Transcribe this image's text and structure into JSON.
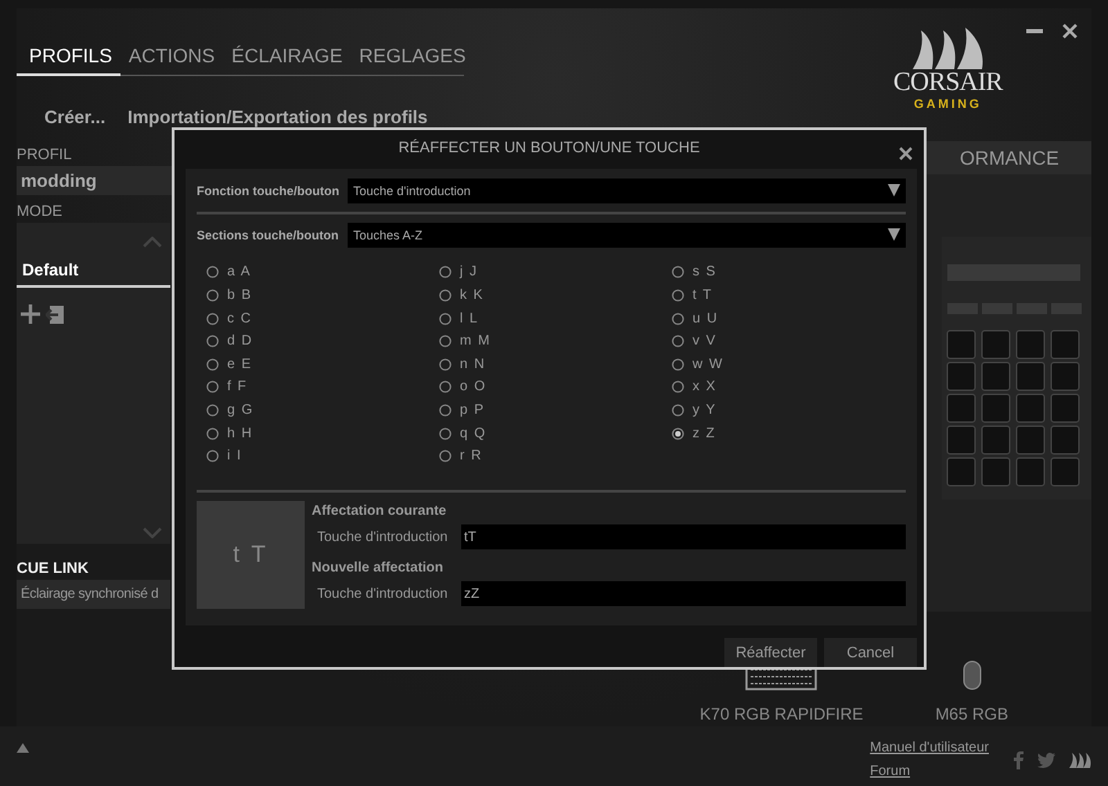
{
  "tabs": [
    {
      "label": "PROFILS",
      "selected": true
    },
    {
      "label": "ACTIONS",
      "selected": false
    },
    {
      "label": "ÉCLAIRAGE",
      "selected": false
    },
    {
      "label": "REGLAGES",
      "selected": false
    }
  ],
  "logo": {
    "name": "CORSAIR",
    "sub": "GAMING"
  },
  "subnav": [
    "Créer...",
    "Importation/Exportation des profils"
  ],
  "profile": {
    "label": "PROFIL",
    "value": "modding"
  },
  "mode": {
    "label": "MODE",
    "items": [
      {
        "label": "Default",
        "selected": true
      }
    ]
  },
  "cue_link": {
    "label": "CUE LINK",
    "value": "Éclairage synchronisé d"
  },
  "right_panel": {
    "tab": "ORMANCE"
  },
  "devices": [
    {
      "name": "K70 RGB RAPIDFIRE",
      "kind": "keyboard"
    },
    {
      "name": "M65 RGB",
      "kind": "mouse"
    }
  ],
  "footer": {
    "links": [
      "Manuel d'utilisateur",
      "Forum"
    ]
  },
  "dialog": {
    "title": "RÉAFFECTER UN BOUTON/UNE TOUCHE",
    "fields": [
      {
        "label": "Fonction touche/bouton",
        "value": "Touche d'introduction"
      },
      {
        "label": "Sections touche/bouton",
        "value": "Touches A-Z"
      }
    ],
    "key_columns": [
      [
        {
          "label": "a A",
          "selected": false
        },
        {
          "label": "b B",
          "selected": false
        },
        {
          "label": "c C",
          "selected": false
        },
        {
          "label": "d D",
          "selected": false
        },
        {
          "label": "e E",
          "selected": false
        },
        {
          "label": "f F",
          "selected": false
        },
        {
          "label": "g G",
          "selected": false
        },
        {
          "label": "h H",
          "selected": false
        },
        {
          "label": "i I",
          "selected": false
        }
      ],
      [
        {
          "label": "j J",
          "selected": false
        },
        {
          "label": "k K",
          "selected": false
        },
        {
          "label": "l L",
          "selected": false
        },
        {
          "label": "m M",
          "selected": false
        },
        {
          "label": "n N",
          "selected": false
        },
        {
          "label": "o O",
          "selected": false
        },
        {
          "label": "p P",
          "selected": false
        },
        {
          "label": "q Q",
          "selected": false
        },
        {
          "label": "r R",
          "selected": false
        }
      ],
      [
        {
          "label": "s S",
          "selected": false
        },
        {
          "label": "t T",
          "selected": false
        },
        {
          "label": "u U",
          "selected": false
        },
        {
          "label": "v V",
          "selected": false
        },
        {
          "label": "w W",
          "selected": false
        },
        {
          "label": "x X",
          "selected": false
        },
        {
          "label": "y Y",
          "selected": false
        },
        {
          "label": "z Z",
          "selected": true
        }
      ]
    ],
    "preview": "t T",
    "assignments": [
      {
        "heading": "Affectation courante",
        "label": "Touche d'introduction",
        "value": "tT"
      },
      {
        "heading": "Nouvelle affectation",
        "label": "Touche d'introduction",
        "value": "zZ"
      }
    ],
    "buttons": [
      "Réaffecter",
      "Cancel"
    ]
  }
}
